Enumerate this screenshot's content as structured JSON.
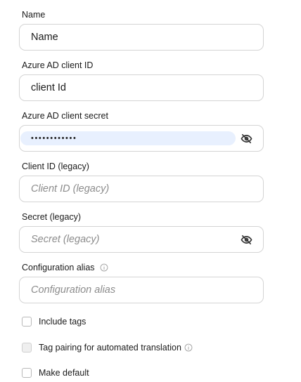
{
  "form": {
    "name": {
      "label": "Name",
      "value": "Name"
    },
    "client_id": {
      "label": "Azure AD client ID",
      "value": "client Id"
    },
    "client_secret": {
      "label": "Azure AD client secret",
      "masked_value": "••••••••••••",
      "icon": "eye-off-icon"
    },
    "client_id_legacy": {
      "label": "Client ID (legacy)",
      "placeholder": "Client ID (legacy)",
      "value": ""
    },
    "secret_legacy": {
      "label": "Secret (legacy)",
      "placeholder": "Secret (legacy)",
      "value": "",
      "icon": "eye-off-icon"
    },
    "configuration_alias": {
      "label": "Configuration alias",
      "placeholder": "Configuration alias",
      "value": "",
      "icon": "info-icon"
    },
    "include_tags": {
      "label": "Include tags",
      "checked": false
    },
    "tag_pairing": {
      "label": "Tag pairing for automated translation",
      "checked": false,
      "disabled": true,
      "icon": "info-icon"
    },
    "make_default": {
      "label": "Make default",
      "checked": false
    }
  },
  "colors": {
    "border": "#d4d4d4",
    "autofill_bg": "#e8f0fe",
    "placeholder": "#8c8c8c",
    "text": "#1a1a1a",
    "icon": "#333333",
    "info_icon": "#a0a0a0"
  }
}
